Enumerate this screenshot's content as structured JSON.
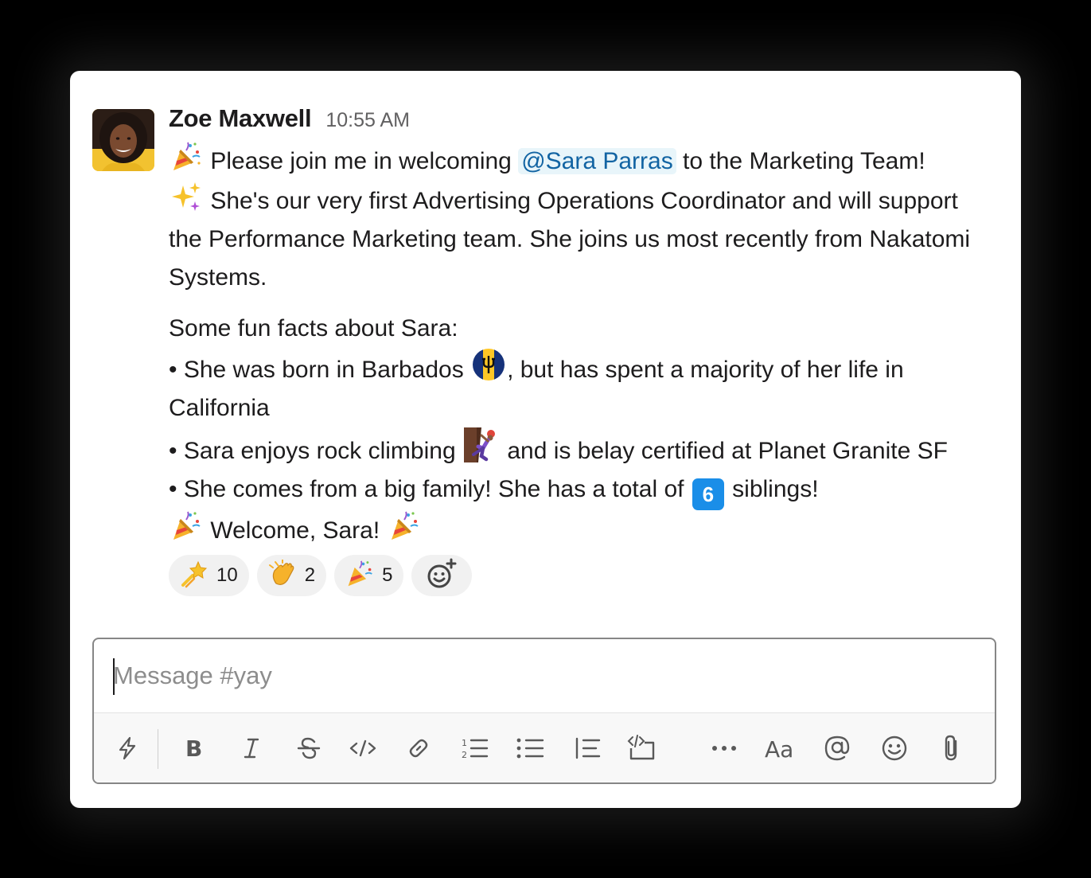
{
  "message": {
    "author": "Zoe Maxwell",
    "time": "10:55 AM",
    "avatar_icon": "avatar-photo",
    "line1_before": " Please join me in welcoming ",
    "mention": "@Sara Parras",
    "line1_after": " to the Marketing Team!",
    "line2": " She's our very first Advertising Operations Coordinator and will support the Performance Marketing team. She joins us most recently from Nakatomi Systems.",
    "facts_intro": "Some fun facts about Sara:",
    "fact1_before": "• She was born in Barbados ",
    "fact1_after": ", but has spent a majority of her life in California",
    "fact2_before": "• Sara enjoys rock climbing ",
    "fact2_after": " and is belay certified at Planet Granite SF",
    "fact3_before": "• She comes from a big family! She has a total of ",
    "fact3_number": "6",
    "fact3_after": " siblings!",
    "welcome": " Welcome, Sara! "
  },
  "reactions": [
    {
      "emoji": "shooting-star-icon",
      "count": "10"
    },
    {
      "emoji": "clapping-hands-icon",
      "count": "2"
    },
    {
      "emoji": "party-popper-icon",
      "count": "5"
    }
  ],
  "composer": {
    "placeholder": "Message #yay",
    "toolbar": [
      "shortcuts-icon",
      "bold-icon",
      "italic-icon",
      "strikethrough-icon",
      "code-icon",
      "link-icon",
      "ordered-list-icon",
      "bulleted-list-icon",
      "blockquote-icon",
      "code-block-icon",
      "more-icon",
      "formatting-icon",
      "mention-icon",
      "emoji-icon",
      "attachment-icon"
    ]
  },
  "colors": {
    "mention_text": "#1264a3",
    "mention_bg": "#e8f5fa",
    "reaction_bg": "#f1f1f1",
    "number_emoji_bg": "#1a8ee8"
  }
}
